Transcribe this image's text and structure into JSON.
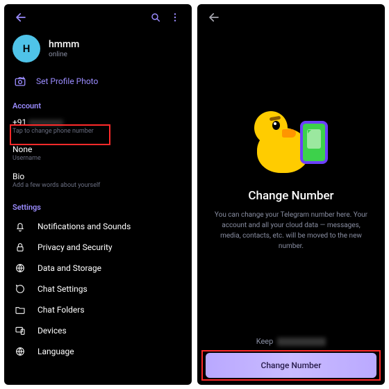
{
  "left": {
    "profile": {
      "initial": "H",
      "name": "hmmm",
      "status": "online"
    },
    "set_photo": "Set Profile Photo",
    "section_account": "Account",
    "account": {
      "phone": {
        "primary": "+91",
        "secondary": "Tap to change phone number"
      },
      "username": {
        "primary": "None",
        "secondary": "Username"
      },
      "bio": {
        "primary": "Bio",
        "secondary": "Add a few words about yourself"
      }
    },
    "section_settings": "Settings",
    "settings": [
      "Notifications and Sounds",
      "Privacy and Security",
      "Data and Storage",
      "Chat Settings",
      "Chat Folders",
      "Devices",
      "Language"
    ]
  },
  "right": {
    "title": "Change Number",
    "desc": "You can change your Telegram number here. Your account and all your cloud data — messages, media, contacts, etc. will be moved to the new number.",
    "keep": "Keep",
    "cta": "Change Number"
  }
}
